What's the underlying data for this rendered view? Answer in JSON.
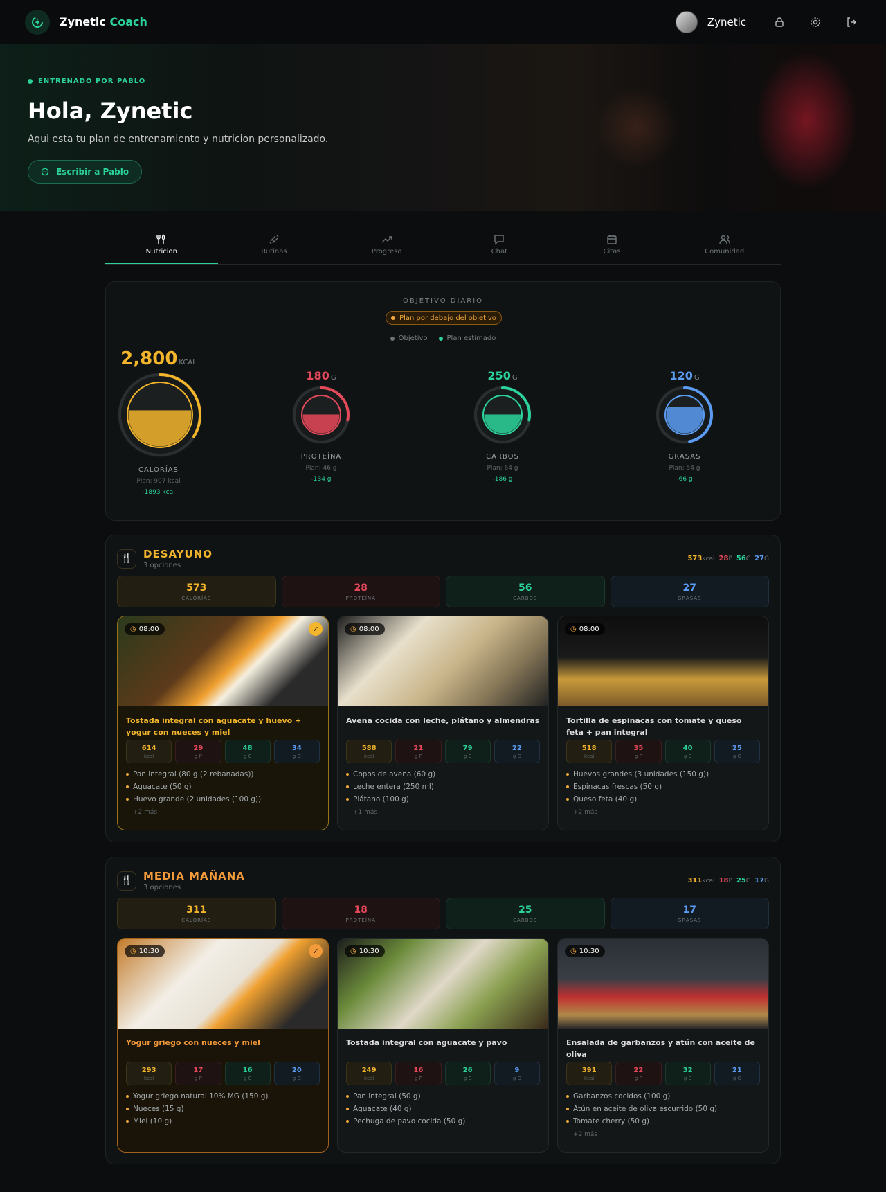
{
  "header": {
    "brand_main": "Zynetic",
    "brand_accent": "Coach",
    "user_name": "Zynetic"
  },
  "hero": {
    "eyebrow": "ENTRENADO POR PABLO",
    "title": "Hola, Zynetic",
    "subtitle": "Aqui esta tu plan de entrenamiento y nutricion personalizado.",
    "button": "Escribir a Pablo"
  },
  "tabs": [
    {
      "label": "Nutricion",
      "icon": "utensils-icon"
    },
    {
      "label": "Rutinas",
      "icon": "dumbbell-icon"
    },
    {
      "label": "Progreso",
      "icon": "trending-up-icon"
    },
    {
      "label": "Chat",
      "icon": "chat-icon"
    },
    {
      "label": "Citas",
      "icon": "calendar-icon"
    },
    {
      "label": "Comunidad",
      "icon": "users-icon"
    }
  ],
  "objective": {
    "title": "OBJETIVO DIARIO",
    "status": "Plan por debajo del objetivo",
    "legend_objective": "Objetivo",
    "legend_plan": "Plan estimado",
    "calories": {
      "value": "2,800",
      "unit": "KCAL",
      "label": "CALORÍAS",
      "plan": "Plan: 907 kcal",
      "diff": "-1893 kcal",
      "fill": 0.32
    },
    "protein": {
      "value": "180",
      "unit": "G",
      "label": "PROTEÍNA",
      "plan": "Plan: 46 g",
      "diff": "-134 g",
      "fill": 0.26
    },
    "carbs": {
      "value": "250",
      "unit": "G",
      "label": "CARBOS",
      "plan": "Plan: 64 g",
      "diff": "-186 g",
      "fill": 0.26
    },
    "fat": {
      "value": "120",
      "unit": "G",
      "label": "GRASAS",
      "plan": "Plan: 54 g",
      "diff": "-66 g",
      "fill": 0.45
    }
  },
  "meals": [
    {
      "name": "DESAYUNO",
      "options_count": "3 opciones",
      "summary": {
        "kcal": "573",
        "p": "28",
        "c": "56",
        "g": "27"
      },
      "totals": {
        "cal": "573",
        "pro": "28",
        "car": "56",
        "fat": "27",
        "cal_l": "CALORÍAS",
        "pro_l": "PROTEÍNA",
        "car_l": "CARBOS",
        "fat_l": "GRASAS"
      },
      "options": [
        {
          "time": "08:00",
          "title": "Tostada integral con aguacate y huevo + yogur con nueces y miel",
          "kcal": "614",
          "p": "29",
          "c": "48",
          "g": "34",
          "ingredients": [
            "Pan integral (80 g (2 rebanadas))",
            "Aguacate (50 g)",
            "Huevo grande (2 unidades (100 g))"
          ],
          "more": "+2 más"
        },
        {
          "time": "08:00",
          "title": "Avena cocida con leche, plátano y almendras",
          "kcal": "588",
          "p": "21",
          "c": "79",
          "g": "22",
          "ingredients": [
            "Copos de avena (60 g)",
            "Leche entera (250 ml)",
            "Plátano (100 g)"
          ],
          "more": "+1 más"
        },
        {
          "time": "08:00",
          "title": "Tortilla de espinacas con tomate y queso feta + pan integral",
          "kcal": "518",
          "p": "35",
          "c": "40",
          "g": "25",
          "ingredients": [
            "Huevos grandes (3 unidades (150 g))",
            "Espinacas frescas (50 g)",
            "Queso feta (40 g)"
          ],
          "more": "+2 más"
        }
      ]
    },
    {
      "name": "MEDIA MAÑANA",
      "options_count": "3 opciones",
      "summary": {
        "kcal": "311",
        "p": "18",
        "c": "25",
        "g": "17"
      },
      "totals": {
        "cal": "311",
        "pro": "18",
        "car": "25",
        "fat": "17",
        "cal_l": "CALORÍAS",
        "pro_l": "PROTEÍNA",
        "car_l": "CARBOS",
        "fat_l": "GRASAS"
      },
      "options": [
        {
          "time": "10:30",
          "title": "Yogur griego con nueces y miel",
          "kcal": "293",
          "p": "17",
          "c": "16",
          "g": "20",
          "ingredients": [
            "Yogur griego natural 10% MG (150 g)",
            "Nueces (15 g)",
            "Miel (10 g)"
          ],
          "more": ""
        },
        {
          "time": "10:30",
          "title": "Tostada integral con aguacate y pavo",
          "kcal": "249",
          "p": "16",
          "c": "26",
          "g": "9",
          "ingredients": [
            "Pan integral (50 g)",
            "Aguacate (40 g)",
            "Pechuga de pavo cocida (50 g)"
          ],
          "more": ""
        },
        {
          "time": "10:30",
          "title": "Ensalada de garbanzos y atún con aceite de oliva",
          "kcal": "391",
          "p": "22",
          "c": "32",
          "g": "21",
          "ingredients": [
            "Garbanzos cocidos (100 g)",
            "Atún en aceite de oliva escurrido (50 g)",
            "Tomate cherry (50 g)"
          ],
          "more": "+2 más"
        }
      ]
    }
  ],
  "units": {
    "kcal": "kcal",
    "p": "g P",
    "c": "g C",
    "g": "g G",
    "sum_p": "P",
    "sum_c": "C",
    "sum_g": "G"
  },
  "colors": {
    "accent": "#2bd39a",
    "calories": "#f3b52b",
    "protein": "#e5485a",
    "carbs": "#2bd39a",
    "fat": "#5b9cf2"
  }
}
